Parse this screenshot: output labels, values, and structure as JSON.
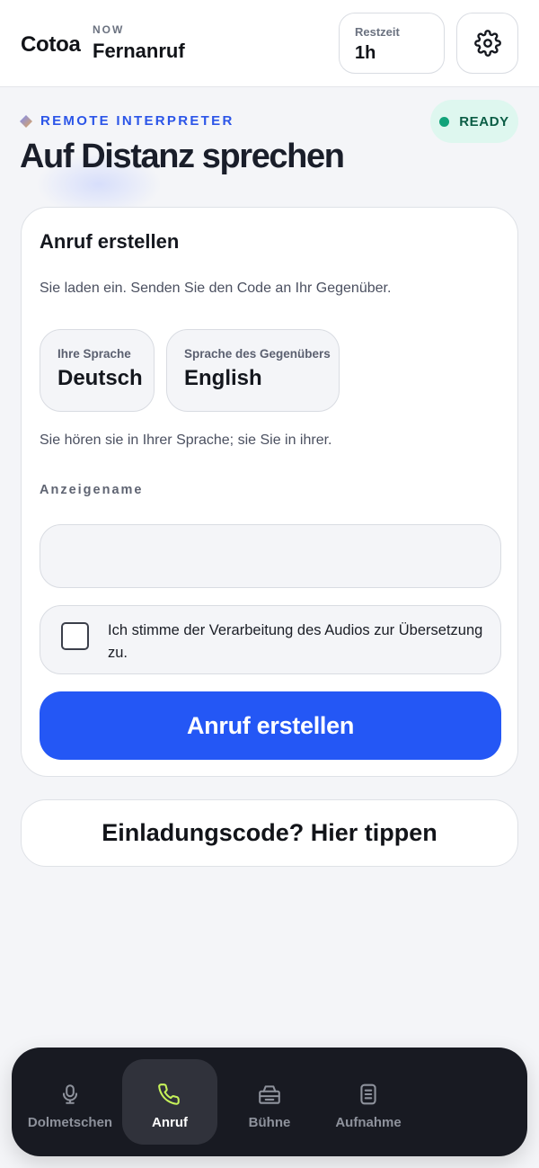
{
  "header": {
    "brand": "Cotoa",
    "now_label": "NOW",
    "now_value": "Fernanruf",
    "restzeit_label": "Restzeit",
    "restzeit_value": "1h",
    "settings_icon": "gear-icon"
  },
  "hero": {
    "eyebrow": "REMOTE INTERPRETER",
    "status": "READY",
    "title": "Auf Distanz sprechen"
  },
  "card": {
    "title": "Anruf erstellen",
    "description": "Sie laden ein. Senden Sie den Code an Ihr Gegenüber.",
    "my_language_label": "Ihre Sprache",
    "my_language_value": "Deutsch",
    "their_language_label": "Sprache des Gegenübers",
    "their_language_value": "English",
    "language_note": "Sie hören sie in Ihrer Sprache; sie Sie in ihrer.",
    "display_name_label": "Anzeigename",
    "display_name_value": "",
    "display_name_placeholder": "",
    "consent_text": "Ich stimme der Verarbeitung des Audios zur Übersetzung zu.",
    "consent_checked": false,
    "create_button": "Anruf erstellen"
  },
  "invite_button": "Einladungscode? Hier tippen",
  "nav": {
    "items": [
      {
        "label": "Dolmetschen",
        "icon": "microphone-icon",
        "active": false
      },
      {
        "label": "Anruf",
        "icon": "phone-icon",
        "active": true
      },
      {
        "label": "Bühne",
        "icon": "stage-icon",
        "active": false
      },
      {
        "label": "Aufnahme",
        "icon": "document-icon",
        "active": false
      }
    ]
  },
  "colors": {
    "accent": "#2457f5",
    "ready_bg": "#def7ef",
    "ready_dot": "#12a37a",
    "nav_bg": "#181a22",
    "active_icon": "#c6f25a"
  }
}
